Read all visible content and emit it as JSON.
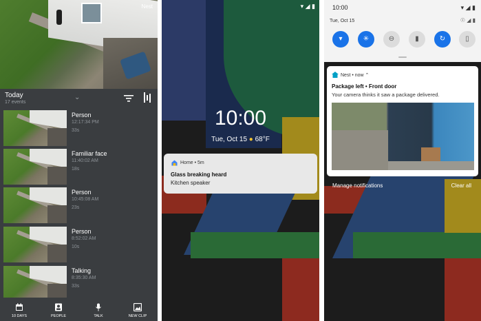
{
  "nest_app": {
    "camera_label": "Nest",
    "section_title": "Today",
    "event_count": "17 events",
    "events": [
      {
        "title": "Person",
        "time": "12:17:34 PM",
        "duration": "33s"
      },
      {
        "title": "Familiar face",
        "time": "11:40:02 AM",
        "duration": "18s"
      },
      {
        "title": "Person",
        "time": "10:45:08 AM",
        "duration": "23s"
      },
      {
        "title": "Person",
        "time": "8:52:02 AM",
        "duration": "10s"
      },
      {
        "title": "Talking",
        "time": "8:35:30 AM",
        "duration": "33s"
      }
    ],
    "nav": [
      {
        "label": "10 DAYS",
        "icon": "calendar-icon"
      },
      {
        "label": "PEOPLE",
        "icon": "person-badge-icon"
      },
      {
        "label": "TALK",
        "icon": "mic-icon"
      },
      {
        "label": "NEW CLIP",
        "icon": "clip-icon"
      }
    ]
  },
  "lock_screen": {
    "clock": "10:00",
    "date": "Tue, Oct 15",
    "weather": "68°F",
    "notification": {
      "app": "Home • 5m",
      "title": "Glass breaking heard",
      "body": "Kitchen speaker"
    }
  },
  "shade": {
    "time": "10:00",
    "date": "Tue, Oct 15",
    "quick_tiles": [
      "wifi-icon",
      "bluetooth-icon",
      "do-not-disturb-icon",
      "flashlight-icon",
      "auto-rotate-icon",
      "battery-saver-icon"
    ],
    "notification": {
      "app": "Nest • now",
      "title": "Package left • Front door",
      "body": "Your camera thinks it saw a package delivered."
    },
    "manage_label": "Manage notifications",
    "clear_label": "Clear all",
    "colors": {
      "tile_accent": "#1a73e8"
    }
  }
}
